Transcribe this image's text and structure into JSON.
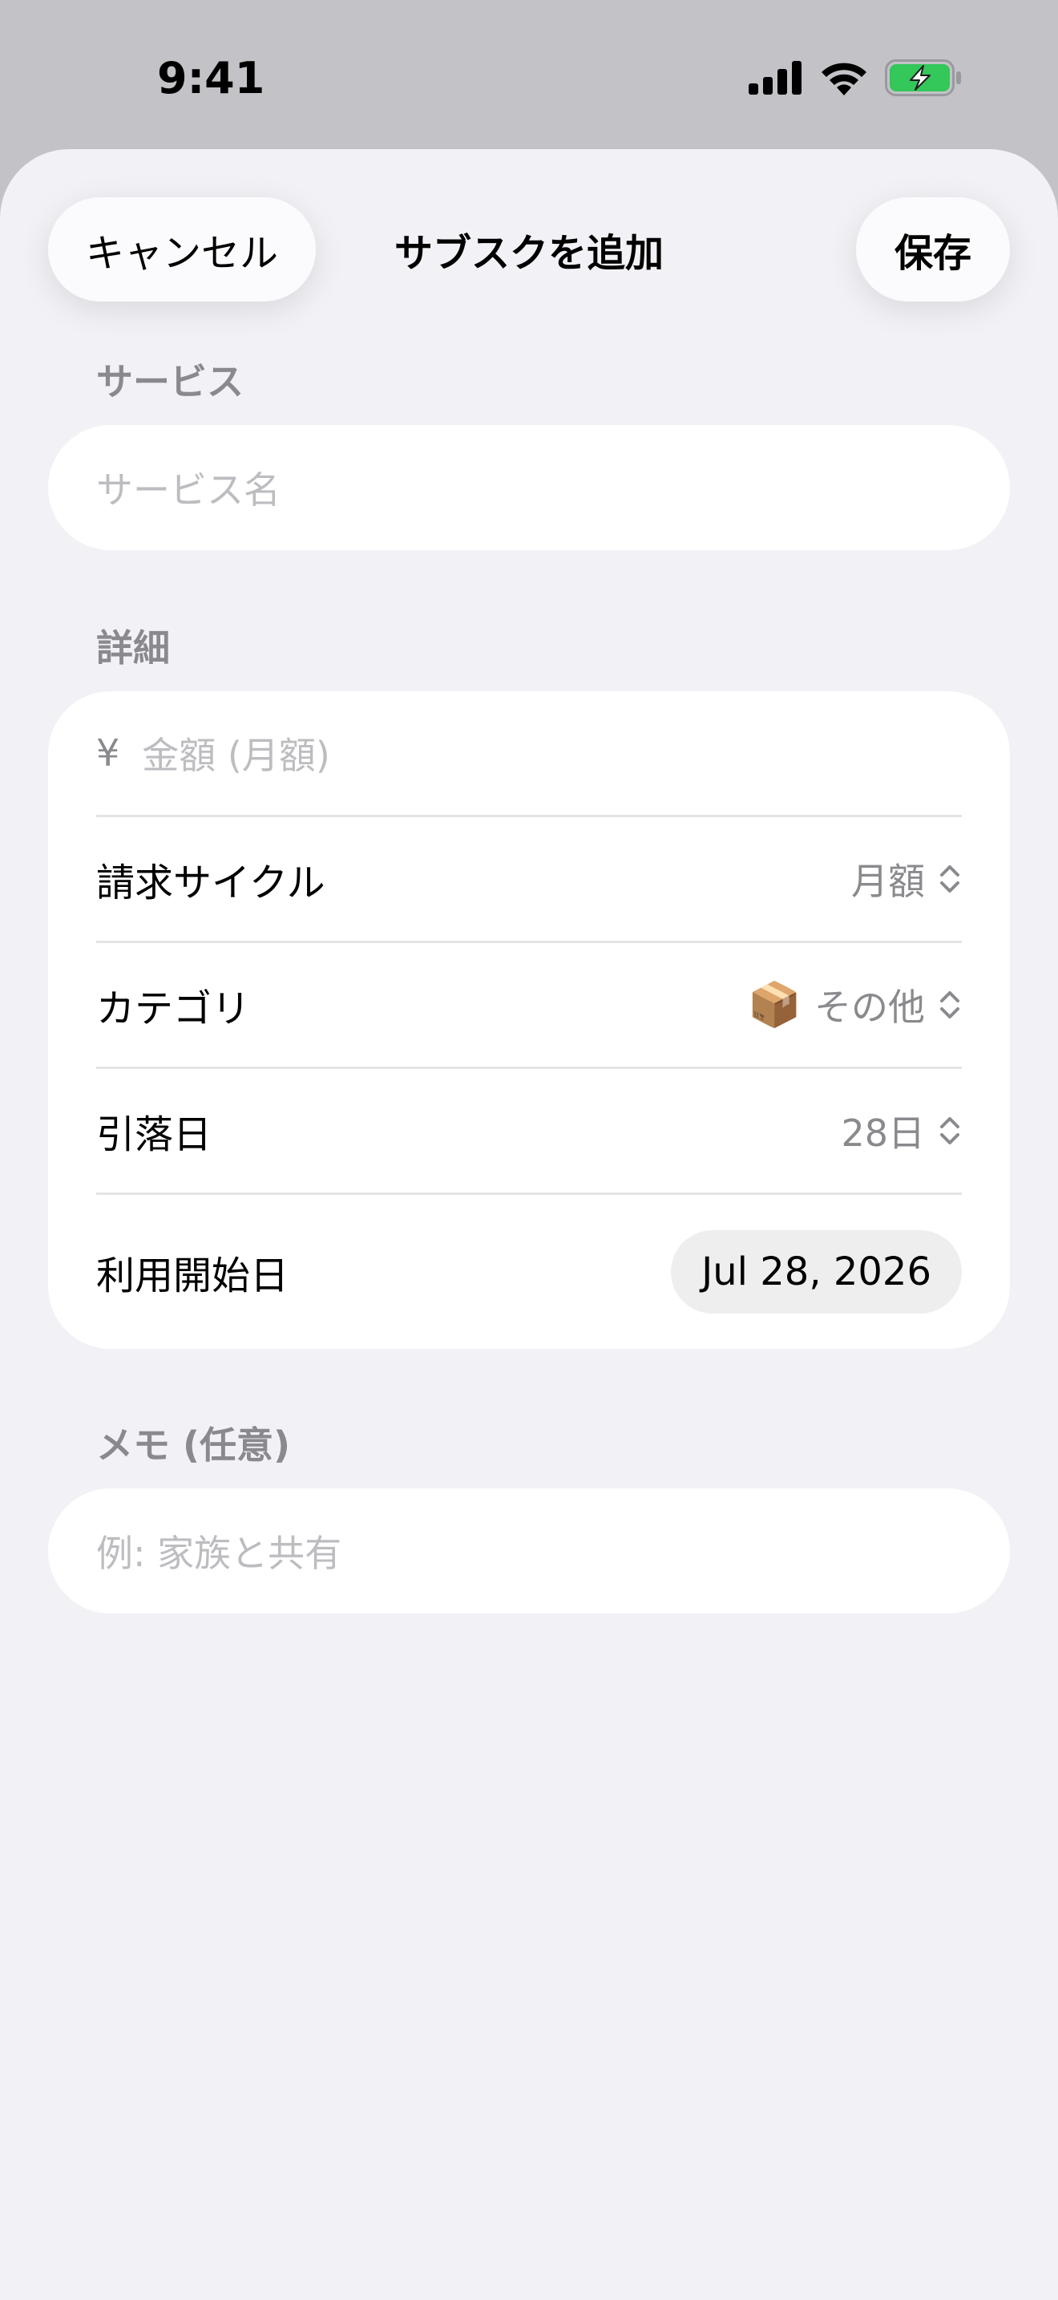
{
  "status_bar": {
    "time": "9:41"
  },
  "nav": {
    "cancel_label": "キャンセル",
    "title": "サブスクを追加",
    "save_label": "保存"
  },
  "service_section": {
    "header": "サービス",
    "name_placeholder": "サービス名"
  },
  "details_section": {
    "header": "詳細",
    "amount": {
      "currency_symbol": "¥",
      "placeholder": "金額 (月額)"
    },
    "billing_cycle": {
      "label": "請求サイクル",
      "value": "月額"
    },
    "category": {
      "label": "カテゴリ",
      "emoji": "📦",
      "value": "その他"
    },
    "payment_day": {
      "label": "引落日",
      "value": "28日"
    },
    "start_date": {
      "label": "利用開始日",
      "value": "Jul 28, 2026"
    }
  },
  "memo_section": {
    "header": "メモ (任意)",
    "placeholder": "例: 家族と共有"
  },
  "colors": {
    "sheet_background": "#f2f1f6",
    "card_background": "#ffffff",
    "secondary_text": "#8a8a8e",
    "placeholder_text": "#bdbdc1",
    "battery_green": "#34c759"
  },
  "icons": {
    "signal": "cellular-signal-icon",
    "wifi": "wifi-icon",
    "battery": "battery-charging-icon",
    "chevron": "chevron-up-down-icon"
  }
}
